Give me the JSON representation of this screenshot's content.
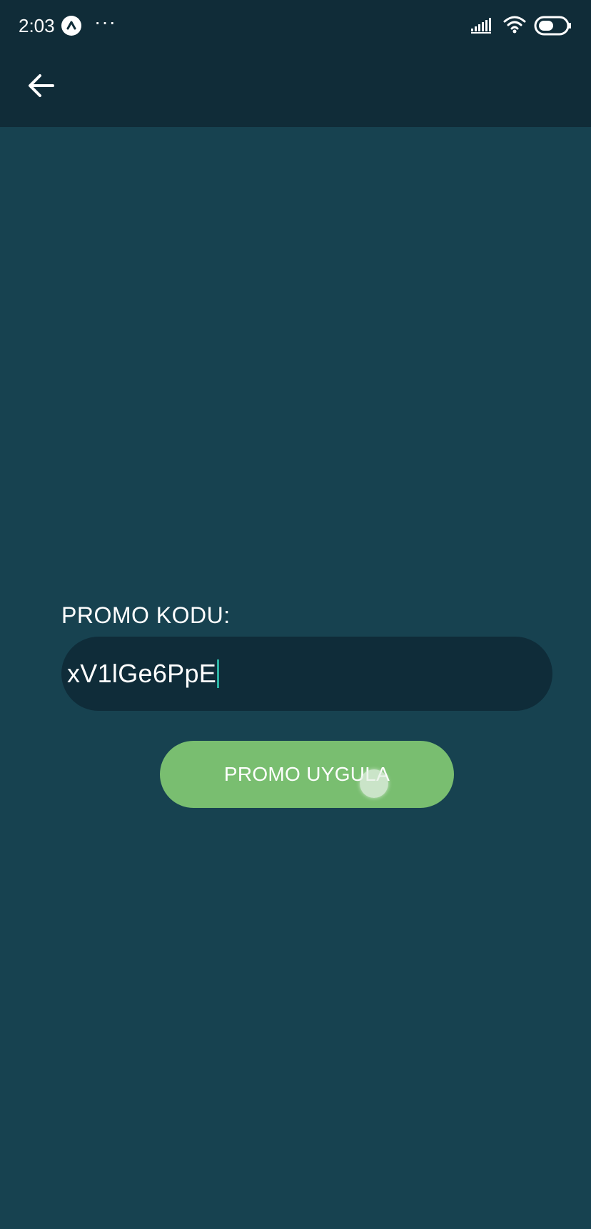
{
  "status_bar": {
    "time": "2:03",
    "more_indicator": "···",
    "icons": [
      "app-notification-icon",
      "signal-icon",
      "wifi-icon",
      "battery-icon"
    ]
  },
  "toolbar": {
    "back_icon": "arrow-left-icon"
  },
  "promo": {
    "label": "PROMO KODU:",
    "input_value": "xV1lGe6PpE",
    "apply_label": "PROMO UYGULA"
  },
  "colors": {
    "background": "#174250",
    "toolbar": "#102c38",
    "input_background": "#0f2c39",
    "accent_button": "#79be70",
    "caret": "#2bb3a4",
    "text": "#ffffff"
  }
}
